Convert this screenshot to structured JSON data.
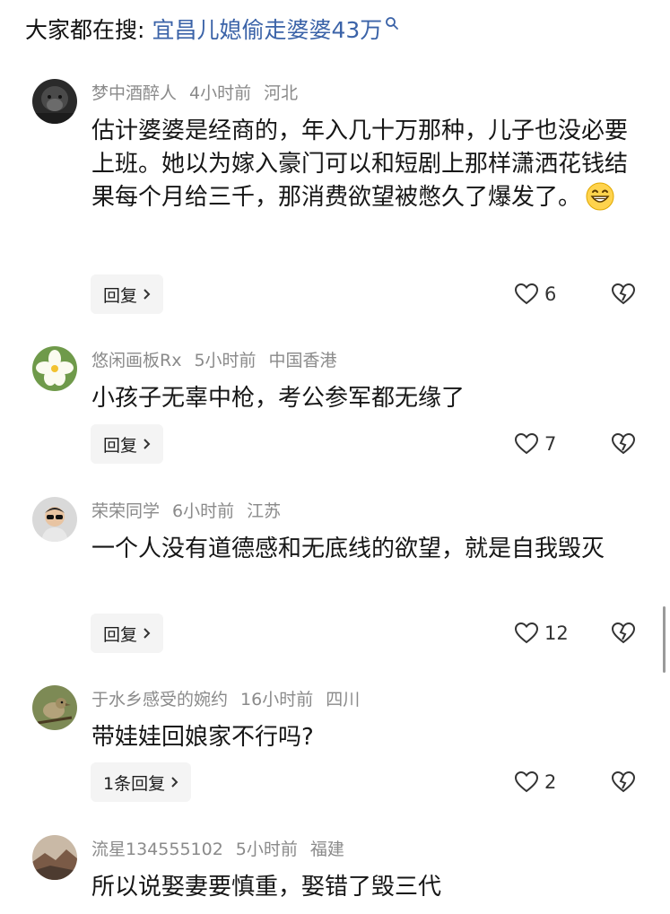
{
  "search": {
    "prefix": "大家都在搜:",
    "term": "宜昌儿媳偷走婆婆43万"
  },
  "comments": [
    {
      "username": "梦中酒醉人",
      "time": "4小时前",
      "location": "河北",
      "text": "估计婆婆是经商的，年入几十万那种，儿子也没必要上班。她以为嫁入豪门可以和短剧上那样潇洒花钱结果每个月给三千，那消费欲望被憋久了爆发了。",
      "emoji": "grinning-face-icon",
      "reply_label": "回复",
      "likes": "6"
    },
    {
      "username": "悠闲画板Rx",
      "time": "5小时前",
      "location": "中国香港",
      "text": "小孩子无辜中枪，考公参军都无缘了",
      "reply_label": "回复",
      "likes": "7"
    },
    {
      "username": "荣荣同学",
      "time": "6小时前",
      "location": "江苏",
      "text": "一个人没有道德感和无底线的欲望，就是自我毁灭",
      "reply_label": "回复",
      "likes": "12"
    },
    {
      "username": "于水乡感受的婉约",
      "time": "16小时前",
      "location": "四川",
      "text": "带娃娃回娘家不行吗?",
      "reply_label": "1条回复",
      "likes": "2"
    },
    {
      "username": "流星134555102",
      "time": "5小时前",
      "location": "福建",
      "text": "所以说娶妻要慎重，娶错了毁三代"
    }
  ]
}
